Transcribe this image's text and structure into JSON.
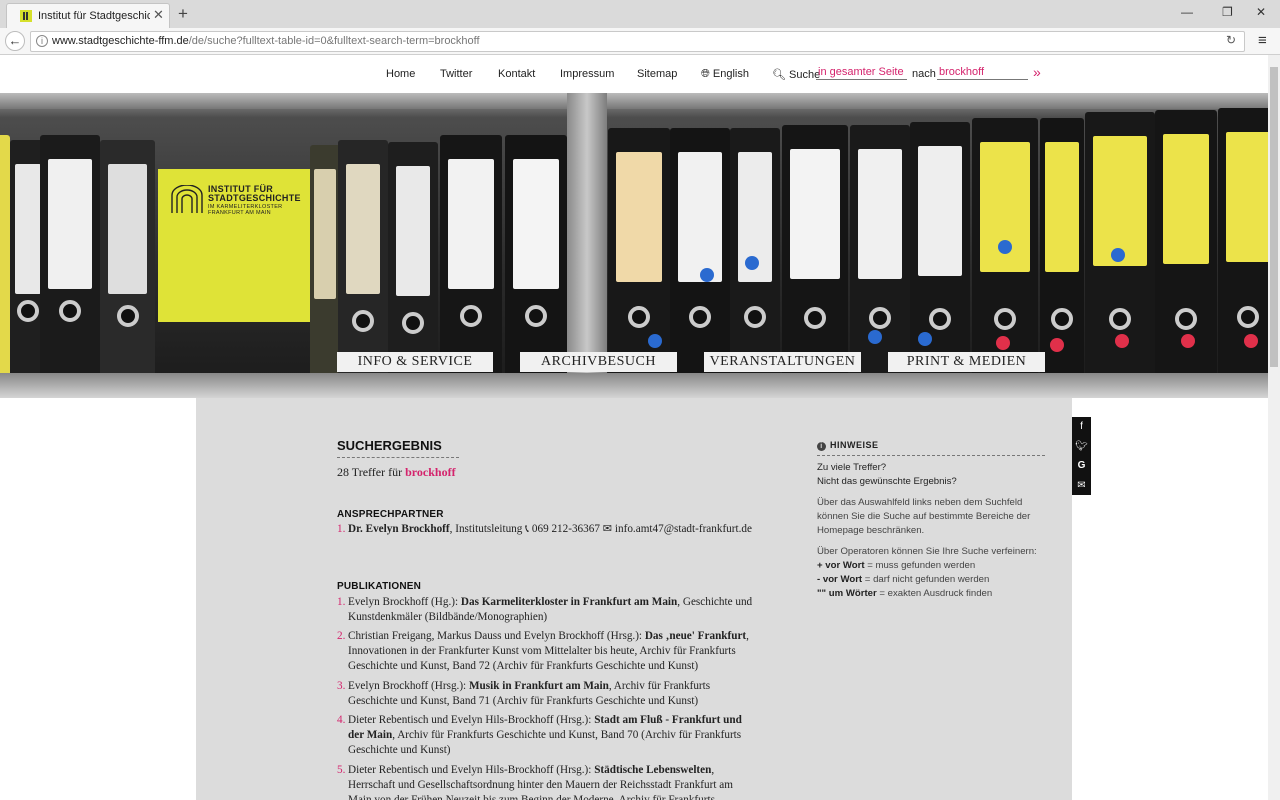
{
  "browser": {
    "tab_title": "Institut für Stadtgeschicht...",
    "url_domain": "www.stadtgeschichte-ffm.de",
    "url_path": "/de/suche?fulltext-table-id=0&fulltext-search-term=brockhoff"
  },
  "nav": {
    "home": "Home",
    "twitter": "Twitter",
    "kontakt": "Kontakt",
    "impressum": "Impressum",
    "sitemap": "Sitemap",
    "english": "English",
    "suche": "Suche",
    "scope": "in gesamter Seite",
    "nach": "nach",
    "term": "brockhoff",
    "go": "»"
  },
  "logo": {
    "line1": "INSTITUT FÜR",
    "line2": "STADTGESCHICHTE",
    "line3": "IM KARMELITERKLOSTER",
    "line4": "FRANKFURT AM MAIN"
  },
  "main_nav": [
    "INFO & SERVICE",
    "ARCHIVBESUCH",
    "VERANSTALTUNGEN",
    "PRINT & MEDIEN"
  ],
  "results": {
    "heading": "SUCHERGEBNIS",
    "hits_prefix": "28 Treffer für",
    "hits_term": "brockhoff",
    "contacts_heading": "ANSPRECHPARTNER",
    "contact": {
      "num": "1.",
      "name": "Dr. Evelyn Brockhoff",
      "role": ", Institutsleitung",
      "phone": "069 212-36367",
      "email": "info.amt47@stadt-frankfurt.de"
    },
    "pubs_heading": "PUBLIKATIONEN",
    "pubs": [
      {
        "num": "1.",
        "pre": "Evelyn Brockhoff (Hg.):",
        "title": "Das Karmeliterkloster in Frankfurt am Main",
        "post": ", Geschichte und Kunstdenkmäler (Bildbände/Monographien)"
      },
      {
        "num": "2.",
        "pre": "Christian Freigang, Markus Dauss und Evelyn Brockhoff (Hrsg.):",
        "title": "Das ‚neue' Frankfurt",
        "post": ", Innovationen in der Frankfurter Kunst vom Mittelalter bis heute, Archiv für Frankfurts Geschichte und Kunst, Band 72 (Archiv für Frankfurts Geschichte und Kunst)"
      },
      {
        "num": "3.",
        "pre": "Evelyn Brockhoff (Hrsg.):",
        "title": "Musik in Frankfurt am Main",
        "post": ", Archiv für Frankfurts Geschichte und Kunst, Band 71 (Archiv für Frankfurts Geschichte und Kunst)"
      },
      {
        "num": "4.",
        "pre": "Dieter Rebentisch und Evelyn Hils-Brockhoff (Hrsg.):",
        "title": "Stadt am Fluß - Frankfurt und der Main",
        "post": ", Archiv für Frankfurts Geschichte und Kunst, Band 70 (Archiv für Frankfurts Geschichte und Kunst)"
      },
      {
        "num": "5.",
        "pre": "Dieter Rebentisch und Evelyn Hils-Brockhoff (Hrsg.):",
        "title": "Städtische Lebenswelten",
        "post": ", Herrschaft und Gesellschaftsordnung hinter den Mauern der Reichsstadt Frankfurt am Main von der Frühen Neuzeit bis zum Beginn der Moderne, Archiv für Frankfurts"
      }
    ]
  },
  "hints": {
    "heading": "HINWEISE",
    "q1": "Zu viele Treffer?",
    "q2": "Nicht das gewünschte Ergebnis?",
    "p1": "Über das Auswahlfeld links neben dem Suchfeld können Sie die Suche auf bestimmte Bereiche der Homepage beschränken.",
    "p2": "Über Operatoren können Sie Ihre Suche verfeinern:",
    "op1_key": "+ vor Wort",
    "op1_val": " = muss gefunden werden",
    "op2_key": "- vor Wort",
    "op2_val": " = darf nicht gefunden werden",
    "op3_key": "\"\" um Wörter",
    "op3_val": " = exakten Ausdruck finden"
  },
  "colors": {
    "accent_pink": "#d4236c",
    "logo_yellow": "#dfe337",
    "content_bg": "#dcdcdc"
  },
  "icons": [
    "globe-icon",
    "search-icon",
    "phone-icon",
    "mail-icon",
    "info-icon",
    "facebook-icon",
    "twitter-icon",
    "google-icon",
    "envelope-icon"
  ]
}
